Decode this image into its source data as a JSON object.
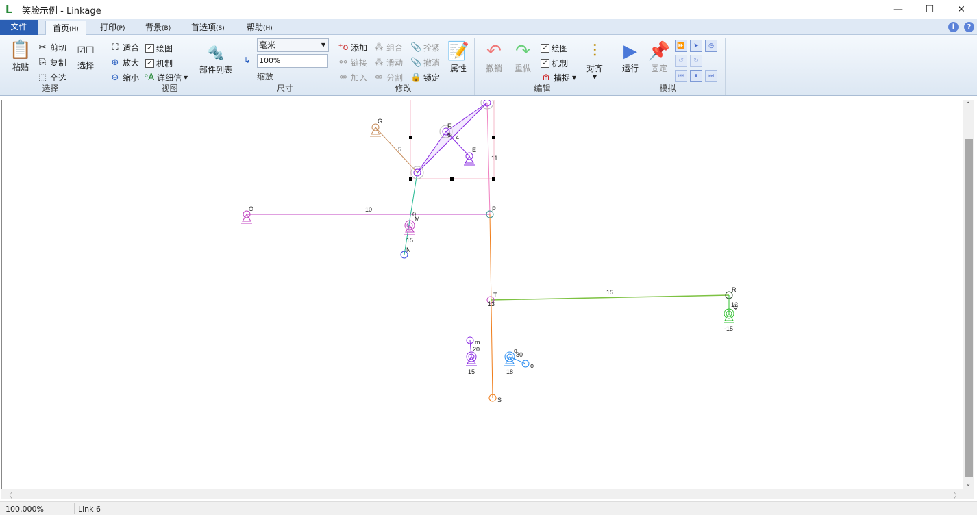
{
  "window": {
    "title": "笑脸示例 - Linkage",
    "minimize": "—",
    "maximize": "☐",
    "close": "✕"
  },
  "tabs": [
    {
      "label": "文件"
    },
    {
      "label": "首页",
      "key": "(H)"
    },
    {
      "label": "打印",
      "key": "(P)"
    },
    {
      "label": "背景",
      "key": "(B)"
    },
    {
      "label": "首选项",
      "key": "(S)"
    },
    {
      "label": "帮助",
      "key": "(H)"
    }
  ],
  "ribbon": {
    "select": {
      "label": "选择",
      "paste": "粘贴",
      "cut": "剪切",
      "copy": "复制",
      "select_all": "全选",
      "select_btn": "选择"
    },
    "view": {
      "label": "视图",
      "fit": "适合",
      "zoom_in": "放大",
      "zoom_out": "缩小",
      "drawing": "绘图",
      "mechanism": "机制",
      "details": "详细信",
      "parts_list": "部件列表"
    },
    "size": {
      "label": "尺寸",
      "unit": "毫米",
      "zoom_value": "100%",
      "zoom_label": "缩放"
    },
    "modify": {
      "label": "修改",
      "add": "添加",
      "combine": "组合",
      "fasten": "拴紧",
      "link": "链接",
      "slide": "滑动",
      "undo_fasten": "撤消",
      "join": "加入",
      "split": "分割",
      "lock": "锁定",
      "properties": "属性"
    },
    "edit": {
      "label": "编辑",
      "undo": "撤销",
      "redo": "重做",
      "drawing": "绘图",
      "mechanism": "机制",
      "snap": "捕捉",
      "align": "对齐"
    },
    "simulate": {
      "label": "模拟",
      "run": "运行",
      "pin": "固定"
    }
  },
  "canvas": {
    "nodes": [
      "G",
      "F",
      "E",
      "O",
      "M",
      "N",
      "P",
      "T",
      "R",
      "S",
      "m",
      "o",
      "q",
      "Q"
    ],
    "numbers": [
      "5",
      "4",
      "11",
      "10",
      "0",
      "6",
      "15",
      "13",
      "12",
      "-15",
      "20",
      "30",
      "15",
      "18",
      "15"
    ]
  },
  "colors": {
    "accent": "#2b5fb4",
    "green_link": "#7dc242",
    "orange_link": "#f07d1a",
    "purple": "#8a2be2",
    "magenta": "#c040c0",
    "teal": "#20b890",
    "blue": "#2a8cf0"
  },
  "status": {
    "zoom": "100.000%",
    "selection": "Link 6"
  }
}
